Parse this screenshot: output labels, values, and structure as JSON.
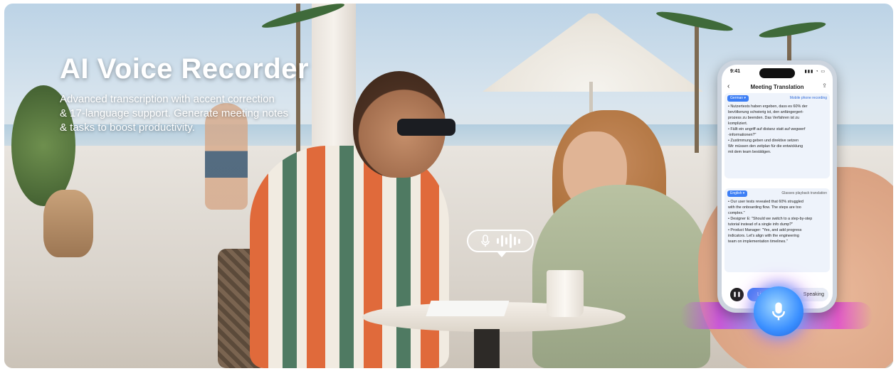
{
  "banner": {
    "headline": "AI Voice Recorder",
    "subline": [
      "Advanced transcription with accent correction",
      "& 17-language support. Generate meeting notes",
      "& tasks to boost productivity."
    ]
  },
  "voice_bubble": {
    "icon": "microphone-icon",
    "bars_icon": "audio-wave-icon"
  },
  "phone": {
    "time": "9:41",
    "title": "Meeting Translation",
    "panel_source": {
      "language": "German",
      "mode": "Mobile phone recording",
      "lines": [
        "• Nutzertests haben ergeben, dass es 60% der",
        "  bevölkerung schwierig ist, den anfängergert-",
        "  prozess zu beenden. Das Verfahren ist zu",
        "  kompliziert.",
        "• Fällt ein angriff auf distanz statt auf wegwerf",
        "  -informationen?\"",
        "• Zustimmung geben und direktive setzen",
        "  Wir müssen den zeitplan für die entwicklung",
        "  mit dem team bestätigen."
      ]
    },
    "panel_target": {
      "language": "English",
      "mode": "Glasses playback translation",
      "lines": [
        "• Our user tests revealed that 60% struggled",
        "  with the onboarding flow. The steps are too",
        "  complex.\"",
        "• Designer E: \"Should we switch to a step-by-step",
        "  tutorial instead of a single info dump?\"",
        "• Product Manager: \"Yes, and add progress",
        "  indicators. Let's align with the engineering",
        "  team on implementation timelines.\""
      ]
    },
    "controls": {
      "listen_label": "Lis",
      "speak_label": "Speaking"
    }
  },
  "colors": {
    "accent_blue": "#3c7ef5",
    "headline_text": "#ffffff",
    "glow_purple": "#c64be6"
  }
}
